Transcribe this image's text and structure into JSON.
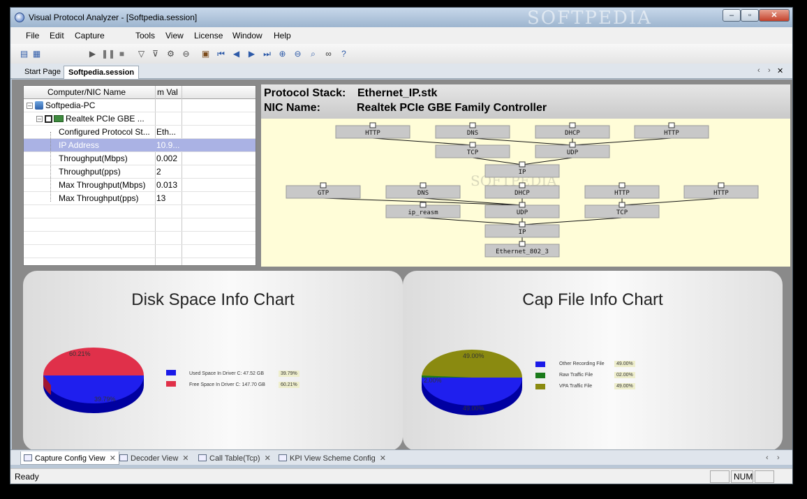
{
  "window": {
    "title": "Visual Protocol Analyzer - [Softpedia.session]",
    "watermark": "SOFTPEDIA",
    "minimize_label": "–",
    "maximize_label": "▫",
    "close_label": "✕"
  },
  "menu": {
    "file": "File",
    "edit": "Edit",
    "capture": "Capture",
    "tools": "Tools",
    "view": "View",
    "license": "License",
    "window": "Window",
    "help": "Help"
  },
  "toolbar_icons": [
    "new-icon",
    "open-icon",
    "start-icon",
    "pause-icon",
    "stop-icon",
    "filter-icon",
    "filter-edit-icon",
    "settings-icon",
    "block-icon",
    "package-icon",
    "first-icon",
    "prev-icon",
    "next-icon",
    "last-icon",
    "zoom-in-icon",
    "zoom-out-icon",
    "find-icon",
    "binoculars-icon",
    "help-icon"
  ],
  "doc_tabs": {
    "start_page": "Start Page",
    "session": "Softpedia.session",
    "scroll_left": "‹",
    "scroll_right": "›",
    "close": "✕"
  },
  "grid": {
    "col_name": "Computer/NIC Name",
    "col_value": "m Val",
    "rows": [
      {
        "name": "Softpedia-PC",
        "value": ""
      },
      {
        "name": "Realtek PCIe GBE ...",
        "value": ""
      },
      {
        "name": "Configured Protocol St...",
        "value": "Eth..."
      },
      {
        "name": "IP Address",
        "value": "10.9..."
      },
      {
        "name": "Throughput(Mbps)",
        "value": "0.002"
      },
      {
        "name": "Throughput(pps)",
        "value": "2"
      },
      {
        "name": "Max Throughput(Mbps)",
        "value": "0.013"
      },
      {
        "name": "Max Throughput(pps)",
        "value": "13"
      }
    ]
  },
  "stack": {
    "protocol_label": "Protocol Stack:",
    "protocol_value": "Ethernet_IP.stk",
    "nic_label": "NIC Name:",
    "nic_value": "Realtek PCIe GBE Family Controller",
    "nodes": [
      "HTTP",
      "DNS",
      "DHCP",
      "HTTP",
      "TCP",
      "UDP",
      "IP",
      "GTP",
      "DNS",
      "DHCP",
      "HTTP",
      "HTTP",
      "ip_reasm",
      "UDP",
      "TCP",
      "IP",
      "Ethernet_802_3"
    ],
    "watermark": "SOFTPEDIA",
    "colors": {
      "background": "#fffdd8",
      "node": "#c8c8c8"
    }
  },
  "disk_chart": {
    "title": "Disk Space Info Chart",
    "used_pct": "39.79%",
    "free_pct": "60.21%",
    "legend": [
      {
        "label": "Used Space In Driver C: 47.52 GB",
        "pct": "39.79%",
        "color": "#1a1ae8"
      },
      {
        "label": "Free Space In Driver C: 147.70 GB",
        "pct": "60.21%",
        "color": "#e03048"
      }
    ]
  },
  "cap_chart": {
    "title": "Cap File Info Chart",
    "slice_labels": [
      "49.00%",
      "2.00%",
      "49.00%"
    ],
    "legend": [
      {
        "label": "Other Recording File",
        "pct": "49.00%",
        "color": "#1a1ae8"
      },
      {
        "label": "Raw Traffic File",
        "pct": "02.00%",
        "color": "#1a7a1a"
      },
      {
        "label": "VPA Traffic File",
        "pct": "49.00%",
        "color": "#8a8a10"
      }
    ]
  },
  "bottom_tabs": [
    {
      "label": "Capture Config View"
    },
    {
      "label": "Decoder View"
    },
    {
      "label": "Call Table(Tcp)"
    },
    {
      "label": "KPI View Scheme Config"
    }
  ],
  "bottom_tab_close": "✕",
  "status": {
    "text": "Ready",
    "num": "NUM"
  }
}
